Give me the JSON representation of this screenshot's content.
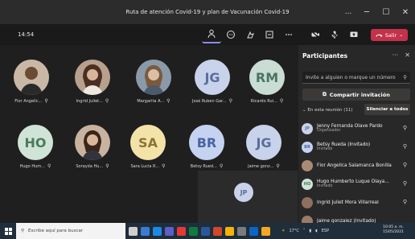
{
  "window": {
    "title": "Ruta de atención Covid-19 y plan de Vacunación Covid-19",
    "controls": {
      "more": "...",
      "minimize": "─",
      "maximize": "☐",
      "close": "✕"
    }
  },
  "meeting": {
    "timer": "14:54",
    "leave_label": "Salir"
  },
  "tiles": [
    {
      "name": "Flor Angelic...",
      "type": "photo",
      "color": "#a98b73"
    },
    {
      "name": "Ingrid Juliet...",
      "type": "photo",
      "color": "#8f6f5e"
    },
    {
      "name": "Margarita A...",
      "type": "photo",
      "color": "#b89a7d"
    },
    {
      "name": "José Ruben Gar...",
      "type": "initials",
      "initials": "JG",
      "bg": "#c8d2ea",
      "fg": "#5b6e9b"
    },
    {
      "name": "Ricardo Rui...",
      "type": "initials",
      "initials": "RM",
      "bg": "#c9ddd4",
      "fg": "#4d7463"
    },
    {
      "name": "Hugo Hum...",
      "type": "initials",
      "initials": "HO",
      "bg": "#cfe3d7",
      "fg": "#4a7a5c"
    },
    {
      "name": "Sorayda Hu...",
      "type": "photo",
      "color": "#9b7c66"
    },
    {
      "name": "Sara Lucia R...",
      "type": "initials",
      "initials": "SA",
      "bg": "#f4e3a8",
      "fg": "#8a7436"
    },
    {
      "name": "Betsy Rued...",
      "type": "initials",
      "initials": "BR",
      "bg": "#c5d3f0",
      "fg": "#4b63a3"
    },
    {
      "name": "Jaime gonz...",
      "type": "initials",
      "initials": "JG",
      "bg": "#c8d2ea",
      "fg": "#5b6e9b"
    }
  ],
  "self_tile": {
    "initials": "JP",
    "bg": "#c8d2ea",
    "fg": "#5b6e9b"
  },
  "panel": {
    "title": "Participantes",
    "invite_placeholder": "Invite a alguien o marque un número",
    "share_label": "Compartir invitación",
    "in_meeting_label": "En esta reunión (11)",
    "mute_all_label": "Silenciar a todos",
    "participants": [
      {
        "name": "Jenny Fernanda Olave Pardo",
        "role": "Organizador",
        "initials": "JP",
        "bg": "#c8d2ea",
        "fg": "#5b6e9b",
        "photo": false
      },
      {
        "name": "Betsy Rueda (Invitado)",
        "role": "Invitado",
        "initials": "BR",
        "bg": "#c5d3f0",
        "fg": "#4b63a3",
        "photo": false
      },
      {
        "name": "Flor Angelica Salamanca Bonilla",
        "role": "",
        "initials": "",
        "bg": "#a98b73",
        "fg": "#ffffff",
        "photo": true
      },
      {
        "name": "Hugo Humberto Luque Olaya...",
        "role": "Invitado",
        "initials": "HO",
        "bg": "#cfe3d7",
        "fg": "#4a7a5c",
        "photo": false
      },
      {
        "name": "Ingrid Juliet Mora Villarreal",
        "role": "",
        "initials": "",
        "bg": "#8f6f5e",
        "fg": "#ffffff",
        "photo": true
      },
      {
        "name": "Jaime gonzalez (Invitado)",
        "role": "",
        "initials": "",
        "bg": "#9b7c66",
        "fg": "#ffffff",
        "photo": true
      }
    ]
  },
  "taskbar": {
    "search_placeholder": "Escribe aquí para buscar",
    "weather": "17°C",
    "language": "ESP",
    "time": "10:05 a. m.",
    "date": "15/05/2021"
  }
}
